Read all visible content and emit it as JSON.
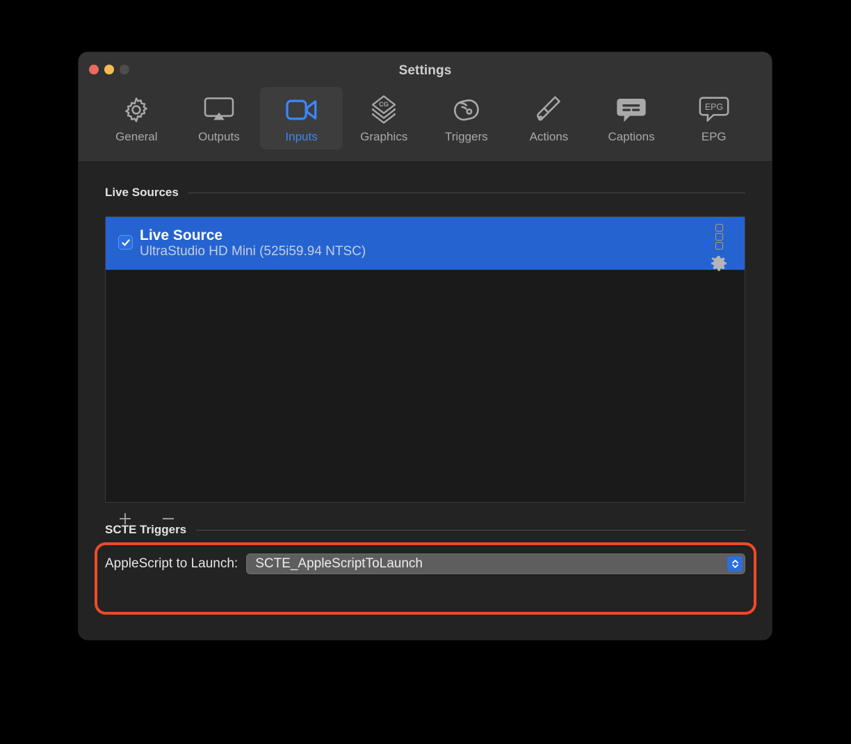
{
  "window": {
    "title": "Settings",
    "traffic_lights": [
      "close",
      "minimize",
      "maximize"
    ]
  },
  "toolbar": {
    "items": [
      {
        "label": "General",
        "icon": "gear-icon",
        "active": false
      },
      {
        "label": "Outputs",
        "icon": "airplay-display-icon",
        "active": false
      },
      {
        "label": "Inputs",
        "icon": "video-camera-icon",
        "active": true
      },
      {
        "label": "Graphics",
        "icon": "cg-layers-icon",
        "active": false
      },
      {
        "label": "Triggers",
        "icon": "wireless-tag-icon",
        "active": false
      },
      {
        "label": "Actions",
        "icon": "flag-wave-icon",
        "active": false
      },
      {
        "label": "Captions",
        "icon": "caption-bubble-icon",
        "active": false
      },
      {
        "label": "EPG",
        "icon": "epg-bubble-icon",
        "active": false
      }
    ]
  },
  "live_sources": {
    "section_title": "Live Sources",
    "rows": [
      {
        "checked": true,
        "name": "Live Source",
        "detail": "UltraStudio HD Mini (525i59.94 NTSC)",
        "selected": true
      }
    ],
    "actions": {
      "add_label": "+",
      "remove_label": "−"
    }
  },
  "scte_triggers": {
    "section_title": "SCTE Triggers",
    "applescript_label": "AppleScript to Launch:",
    "applescript_value": "SCTE_AppleScriptToLaunch",
    "highlighted": true
  },
  "colors": {
    "window_background": "#232323",
    "titlebar_background": "#333333",
    "selection_blue": "#2563d1",
    "accent_blue": "#3b87f7",
    "annotation_red": "#f04a28",
    "list_background": "#1a1a1a",
    "handle_gold": "#c59a5a"
  }
}
